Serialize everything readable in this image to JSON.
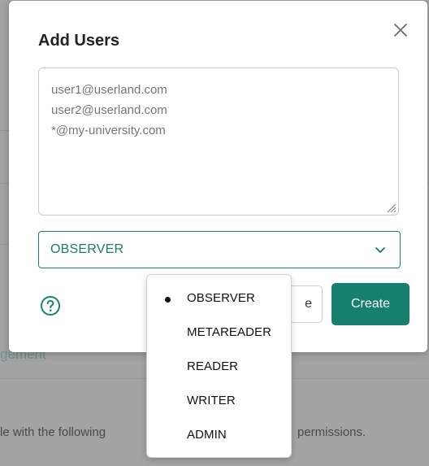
{
  "background": {
    "heading_fragment": "gement",
    "text_left": "le with the following",
    "text_right": "permissions."
  },
  "modal": {
    "title": "Add Users",
    "close_icon": "close-icon",
    "emails_value": "user1@userland.com\nuser2@userland.com\n*@my-university.com",
    "role_select": {
      "value": "OBSERVER",
      "options": [
        "OBSERVER",
        "METAREADER",
        "READER",
        "WRITER",
        "ADMIN"
      ],
      "selected_index": 0
    },
    "help_icon": "help-circle-icon",
    "cancel_label_fragment": "e",
    "create_label": "Create",
    "colors": {
      "accent": "#17806f",
      "select_text": "#1b7a6c"
    }
  }
}
